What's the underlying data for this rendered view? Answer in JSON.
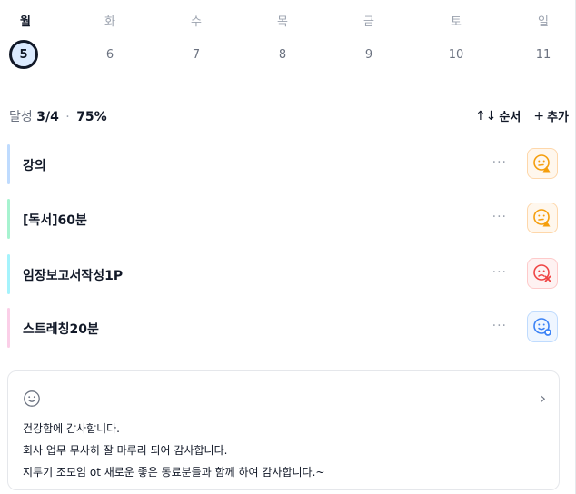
{
  "week": [
    {
      "name": "월",
      "num": "5",
      "active": true
    },
    {
      "name": "화",
      "num": "6"
    },
    {
      "name": "수",
      "num": "7"
    },
    {
      "name": "목",
      "num": "8"
    },
    {
      "name": "금",
      "num": "9"
    },
    {
      "name": "토",
      "num": "10"
    },
    {
      "name": "일",
      "num": "11"
    }
  ],
  "summary": {
    "label": "달성",
    "count": "3/4",
    "separator": "·",
    "percent": "75%"
  },
  "actions": {
    "sort_icon": "↑↓",
    "sort_label": "순서",
    "add_icon": "+",
    "add_label": "추가"
  },
  "tasks": [
    {
      "label": "강의",
      "bar_color": "#bfdbfe",
      "status": "warning-face-icon",
      "status_color": "#f59e0b",
      "status_bg": "#fff7ed",
      "more": "···"
    },
    {
      "label": "[독서]60분",
      "bar_color": "#a7f3d0",
      "status": "warning-face-icon",
      "status_color": "#f59e0b",
      "status_bg": "#fff7ed",
      "more": "···"
    },
    {
      "label": "임장보고서작성1P",
      "bar_color": "#a5f3fc",
      "status": "fail-face-icon",
      "status_color": "#ef4444",
      "status_bg": "#fef2f2",
      "more": "···"
    },
    {
      "label": "스트레칭20분",
      "bar_color": "#fbcfe8",
      "status": "done-face-icon",
      "status_color": "#3b82f6",
      "status_bg": "#eff6ff",
      "more": "···"
    }
  ],
  "gratitude": {
    "icon": "smile-icon",
    "chevron": "›",
    "lines": [
      "건강함에 감사합니다.",
      "회사 업무 무사히 잘 마루리 되어 감사합니다.",
      "지투기 조모임 ot 새로운 좋은 동료분들과 함께 하여 감사합니다.~"
    ]
  }
}
